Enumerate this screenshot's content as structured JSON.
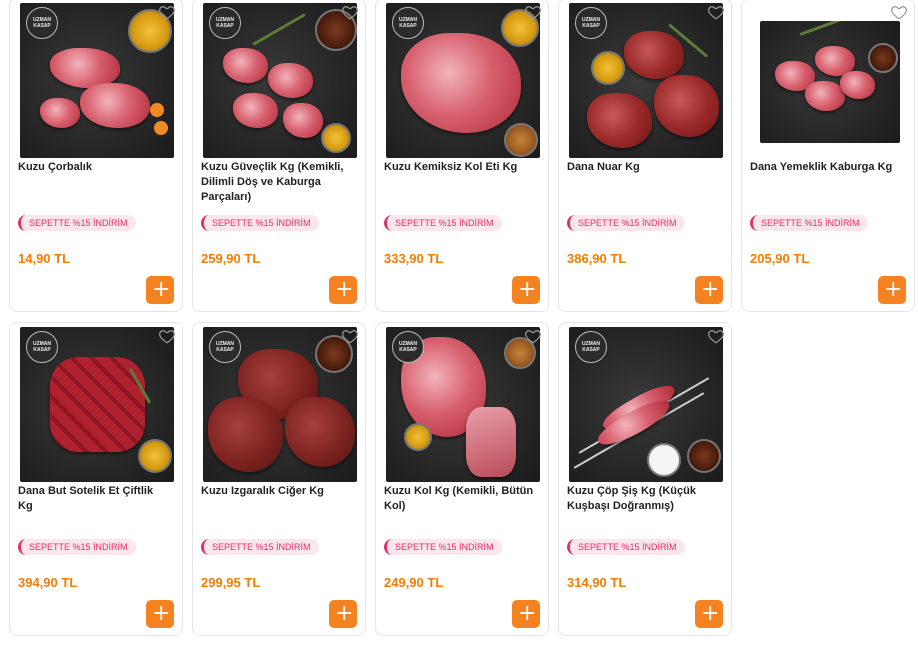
{
  "badge_text": "SEPETTE %15 İNDİRİM",
  "logo_text": "UZMAN KASAP",
  "add_label": "+",
  "colors": {
    "price": "#f57c00",
    "add_button": "#f58220",
    "badge": "#e0306a"
  },
  "products": [
    {
      "title": "Kuzu Çorbalık",
      "price": "14,90 TL"
    },
    {
      "title": "Kuzu Güveçlik Kg (Kemikli, Dilimli Döş ve Kaburga Parçaları)",
      "price": "259,90 TL"
    },
    {
      "title": "Kuzu Kemiksiz Kol Eti Kg",
      "price": "333,90 TL"
    },
    {
      "title": "Dana Nuar Kg",
      "price": "386,90 TL"
    },
    {
      "title": "Dana Yemeklik Kaburga Kg",
      "price": "205,90 TL"
    },
    {
      "title": "Dana But Sotelik Et Çiftlik Kg",
      "price": "394,90 TL"
    },
    {
      "title": "Kuzu Izgaralık Ciğer Kg",
      "price": "299,95 TL"
    },
    {
      "title": "Kuzu Kol Kg (Kemikli, Bütün Kol)",
      "price": "249,90 TL"
    },
    {
      "title": "Kuzu Çöp Şiş Kg (Küçük Kuşbaşı Doğranmış)",
      "price": "314,90 TL"
    }
  ]
}
